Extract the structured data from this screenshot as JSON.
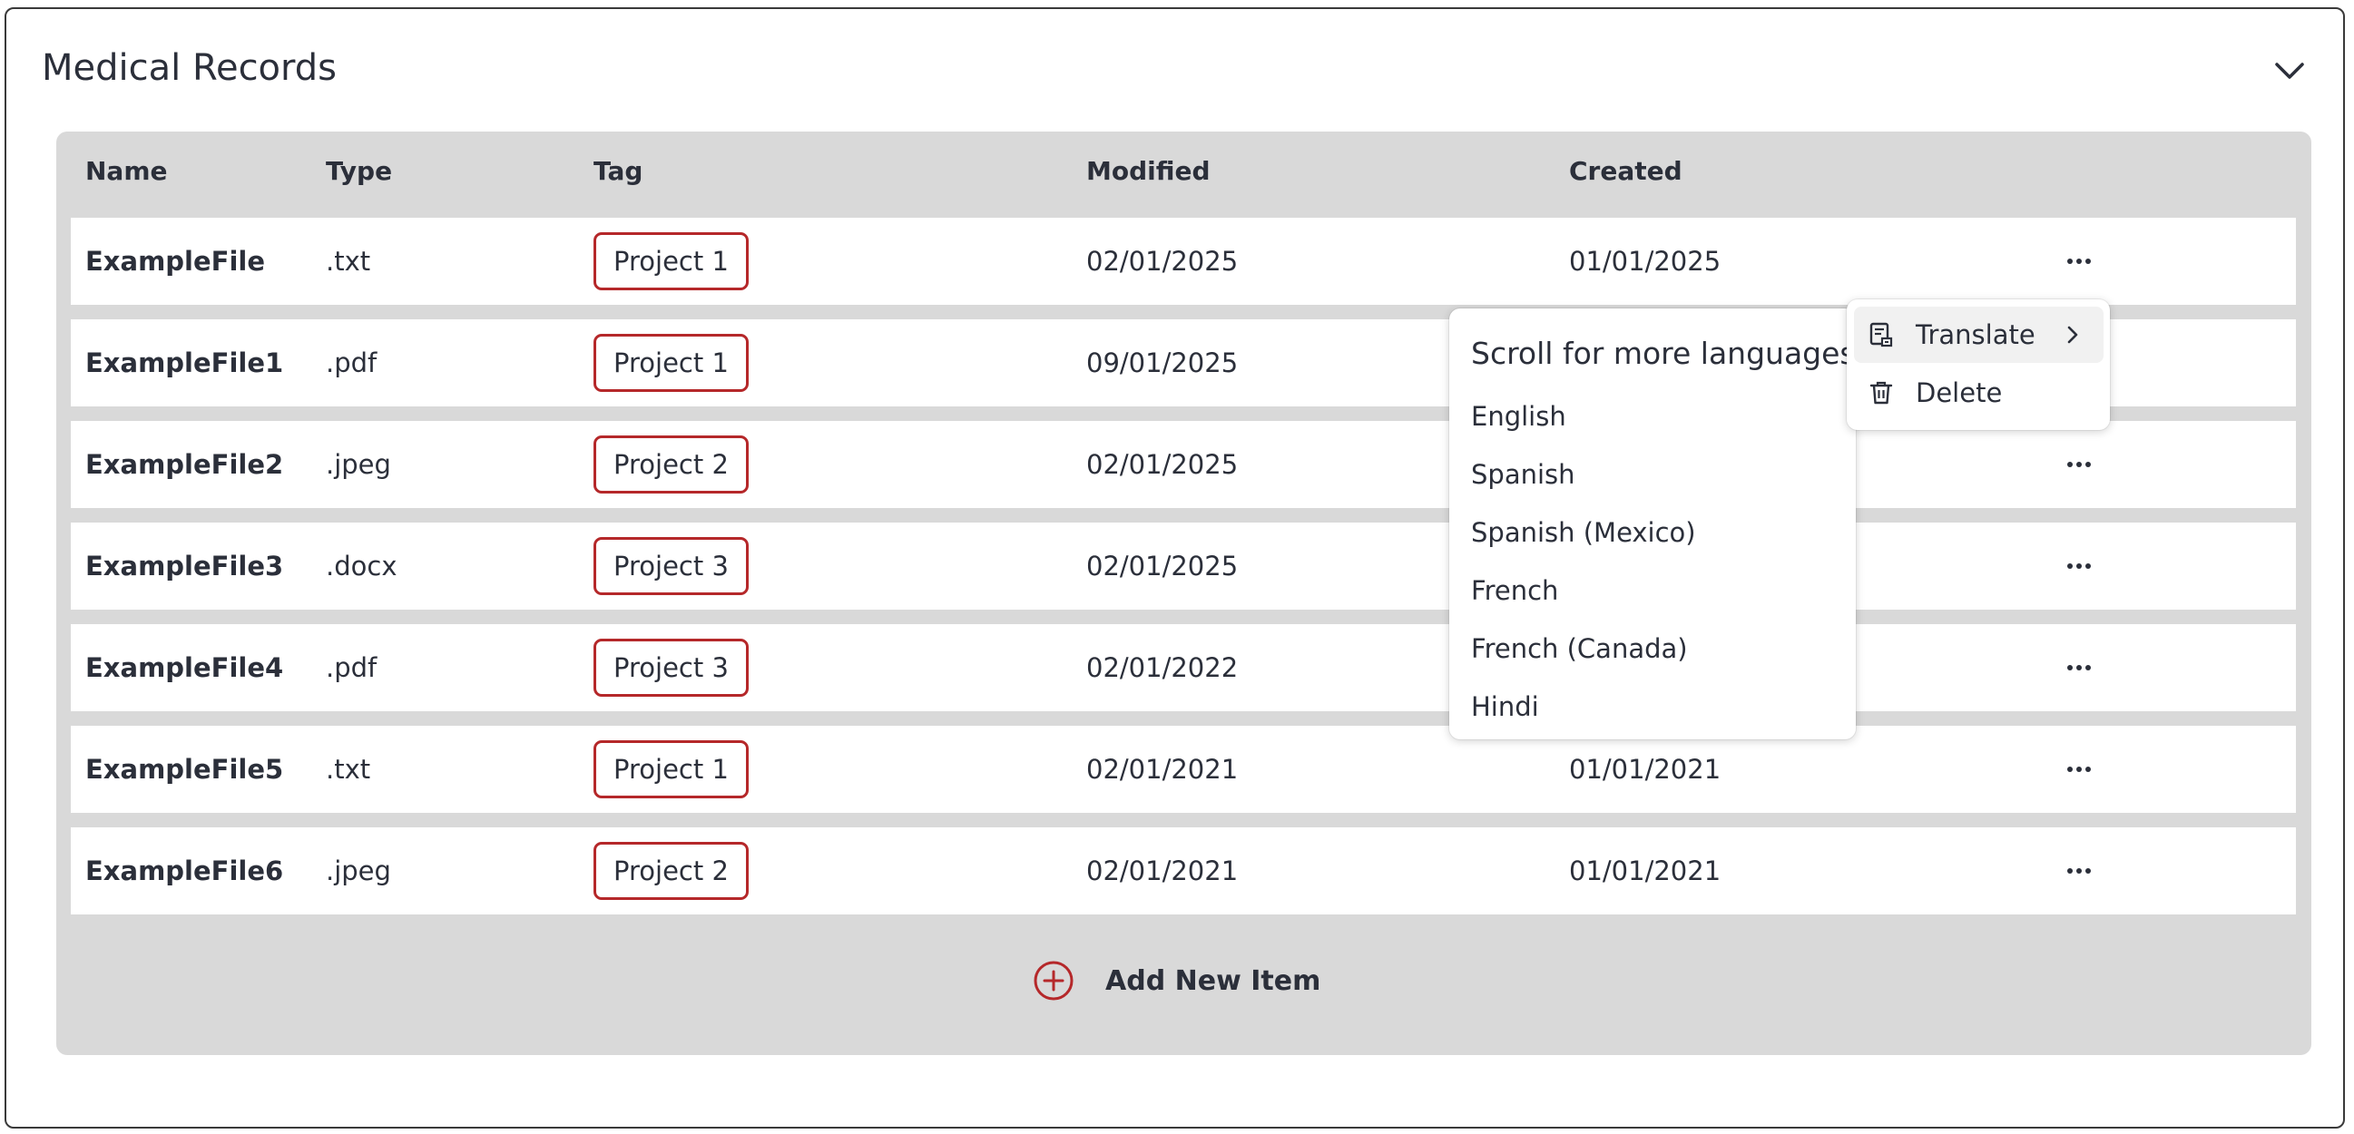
{
  "section": {
    "title": "Medical Records"
  },
  "table": {
    "columns": [
      "Name",
      "Type",
      "Tag",
      "Modified",
      "Created"
    ],
    "rows": [
      {
        "name": "ExampleFile",
        "type": ".txt",
        "tag": "Project 1",
        "modified": "02/01/2025",
        "created": "01/01/2025"
      },
      {
        "name": "ExampleFile1",
        "type": ".pdf",
        "tag": "Project 1",
        "modified": "09/01/2025",
        "created": ""
      },
      {
        "name": "ExampleFile2",
        "type": ".jpeg",
        "tag": "Project 2",
        "modified": "02/01/2025",
        "created": ""
      },
      {
        "name": "ExampleFile3",
        "type": ".docx",
        "tag": "Project 3",
        "modified": "02/01/2025",
        "created": ""
      },
      {
        "name": "ExampleFile4",
        "type": ".pdf",
        "tag": "Project 3",
        "modified": "02/01/2022",
        "created": ""
      },
      {
        "name": "ExampleFile5",
        "type": ".txt",
        "tag": "Project 1",
        "modified": "02/01/2021",
        "created": "01/01/2021"
      },
      {
        "name": "ExampleFile6",
        "type": ".jpeg",
        "tag": "Project 2",
        "modified": "02/01/2021",
        "created": "01/01/2021"
      }
    ],
    "add_label": "Add New Item"
  },
  "row_menu": {
    "items": [
      {
        "label": "Translate",
        "icon": "translate-icon"
      },
      {
        "label": "Delete",
        "icon": "trash-icon"
      }
    ]
  },
  "language_menu": {
    "title": "Scroll for more languages",
    "languages": [
      "English",
      "Spanish",
      "Spanish (Mexico)",
      "French",
      "French (Canada)",
      "Hindi"
    ]
  },
  "colors": {
    "accent": "#b5282a",
    "panel": "#d9d9d9",
    "text": "#2b2f3a"
  }
}
